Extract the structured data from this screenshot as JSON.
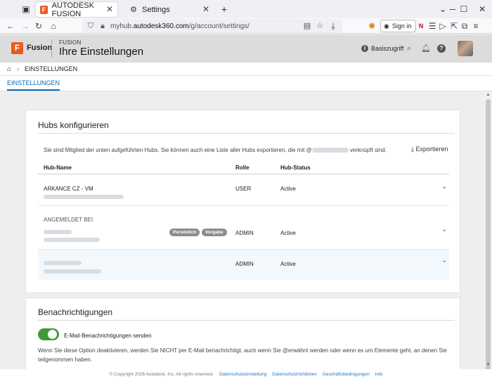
{
  "browser": {
    "tabs": [
      {
        "title": "AUTODESK FUSION",
        "active": true
      },
      {
        "title": "Settings",
        "active": false
      }
    ],
    "url_prefix": "myhub.",
    "url_domain": "autodesk360.com",
    "url_path": "/g/account/settings/",
    "signin_label": "Sign in"
  },
  "header": {
    "product": "Fusion",
    "section_small": "FUSION",
    "page_title": "Ihre Einstellungen",
    "access_label": "Basiszugriff"
  },
  "breadcrumb": {
    "current": "EINSTELLUNGEN"
  },
  "subtabs": [
    {
      "label": "EINSTELLUNGEN",
      "active": true
    }
  ],
  "hubs": {
    "title": "Hubs konfigurieren",
    "desc_before": "Sie sind Mitglied der unten aufgeführten Hubs. Sie können auch eine Liste aller Hubs exportieren, die mit @",
    "desc_after": " verknüpft sind.",
    "export_label": "Exportieren",
    "columns": {
      "name": "Hub-Name",
      "role": "Rolle",
      "status": "Hub-Status"
    },
    "rows": [
      {
        "name": "ARKANCE CZ - VM",
        "role": "USER",
        "status": "Active"
      },
      {
        "name": "ANGEMELDET BEI",
        "role": "ADMIN",
        "status": "Active",
        "badges": [
          "Persönlich",
          "Vorgabe"
        ]
      },
      {
        "name": "",
        "role": "ADMIN",
        "status": "Active"
      }
    ]
  },
  "notifications": {
    "title": "Benachrichtigungen",
    "toggle_label": "E-Mail-Benachrichtigungen senden",
    "toggle_on": true,
    "description": "Wenn Sie diese Option deaktivieren, werden Sie NICHT per E-Mail benachrichtigt, auch wenn Sie @erwähnt werden oder wenn es um Elemente geht, an denen Sie teilgenommen haben."
  },
  "footer": {
    "copyright": "© Copyright 2026 Autodesk, Inc. All rights reserved.",
    "links": [
      "Datenschutzeinstellung",
      "Datenschutzrichtlinien",
      "Geschäftsbedingungen",
      "Info"
    ]
  },
  "colors": {
    "accent": "#1a77c9",
    "toggle": "#3e9a37",
    "brand": "#e95b1c"
  }
}
